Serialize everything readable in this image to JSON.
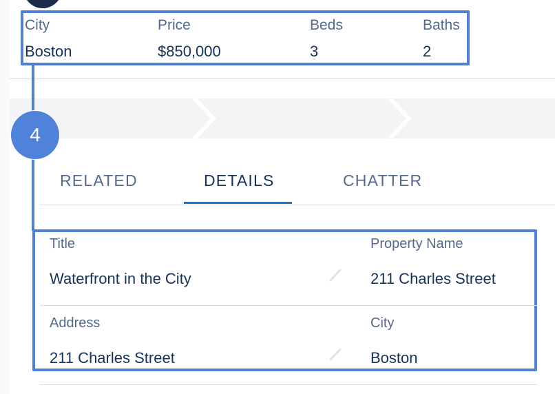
{
  "summary": {
    "fields": [
      {
        "label": "City",
        "value": "Boston"
      },
      {
        "label": "Price",
        "value": "$850,000"
      },
      {
        "label": "Beds",
        "value": "3"
      },
      {
        "label": "Baths",
        "value": "2"
      }
    ]
  },
  "step_badge": "4",
  "tabs": [
    {
      "label": "RELATED"
    },
    {
      "label": "DETAILS"
    },
    {
      "label": "CHATTER"
    }
  ],
  "details": {
    "rows": [
      {
        "left": {
          "label": "Title",
          "value": "Waterfront in the City"
        },
        "right": {
          "label": "Property Name",
          "value": "211 Charles Street"
        }
      },
      {
        "left": {
          "label": "Address",
          "value": "211 Charles Street"
        },
        "right": {
          "label": "City",
          "value": "Boston"
        }
      }
    ]
  },
  "colors": {
    "highlight": "#4f7fd6",
    "badge": "#4f83da",
    "tab_active_underline": "#1d73c9",
    "text_primary": "#16325c",
    "text_label": "#54698d"
  },
  "icons": {
    "edit": "pencil-icon"
  }
}
